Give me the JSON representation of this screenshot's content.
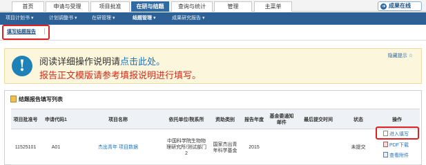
{
  "topnav": {
    "tabs": [
      {
        "label": "首页"
      },
      {
        "label": "申请与受理"
      },
      {
        "label": "项目批准"
      },
      {
        "label": "在研与结题"
      },
      {
        "label": "查询与统计"
      },
      {
        "label": "管理"
      },
      {
        "label": "主菜单"
      }
    ],
    "active_tab": "在研与结题",
    "online_button": "成果在线"
  },
  "subnav": {
    "items": [
      {
        "label": "项目计划书 ▾"
      },
      {
        "label": "计划调整书 ▾"
      },
      {
        "label": "在研管理 ▾"
      },
      {
        "label": "结题管理 ▾"
      },
      {
        "label": "成果研究报告 ▾"
      }
    ],
    "active_item": "结题管理 ▾"
  },
  "breadcrumb": {
    "label": "填写结题报告"
  },
  "notice": {
    "line1_prefix": "阅读详细操作说明请",
    "line1_link": "点击此处。",
    "line2": "报告正文模版请参考填报说明进行填写。",
    "hide_tip": "隐藏提示 ☆"
  },
  "panel": {
    "title": "结题报告填写列表",
    "headers": [
      "项目批准号",
      "申请代码1",
      "项目名称",
      "依托单位/院系所",
      "资助类别",
      "报告年度",
      "基金委通知邮件",
      "最后提交时间",
      "状态",
      "操作"
    ],
    "rows": [
      {
        "approval_no": "11525101",
        "app_code": "A01",
        "project_name": "杰出青年 项目数据",
        "institution": "中国科学院生物物理研究所/测试部门2",
        "funding_type": "国家杰出青年科学基金",
        "report_year": "2015",
        "notice_mail": "",
        "last_submit": "",
        "status": "未提交",
        "ops": [
          "进入填写",
          "PDF下载",
          "查看附件"
        ]
      }
    ]
  },
  "colors": {
    "nav_active": "#2f6aa3",
    "subnav_bg": "#2d6196",
    "notice_bg": "#fbf6dc",
    "notice_red": "#d32a1a",
    "link_blue": "#1e73c0",
    "highlight_red": "#e02020"
  },
  "icons": {
    "online": "circle-arrow-icon",
    "notice": "info-exclamation-icon",
    "panel": "report-list-icon",
    "enter": "edit-doc-icon",
    "pdf": "pdf-icon",
    "attachment": "view-attachment-icon"
  }
}
